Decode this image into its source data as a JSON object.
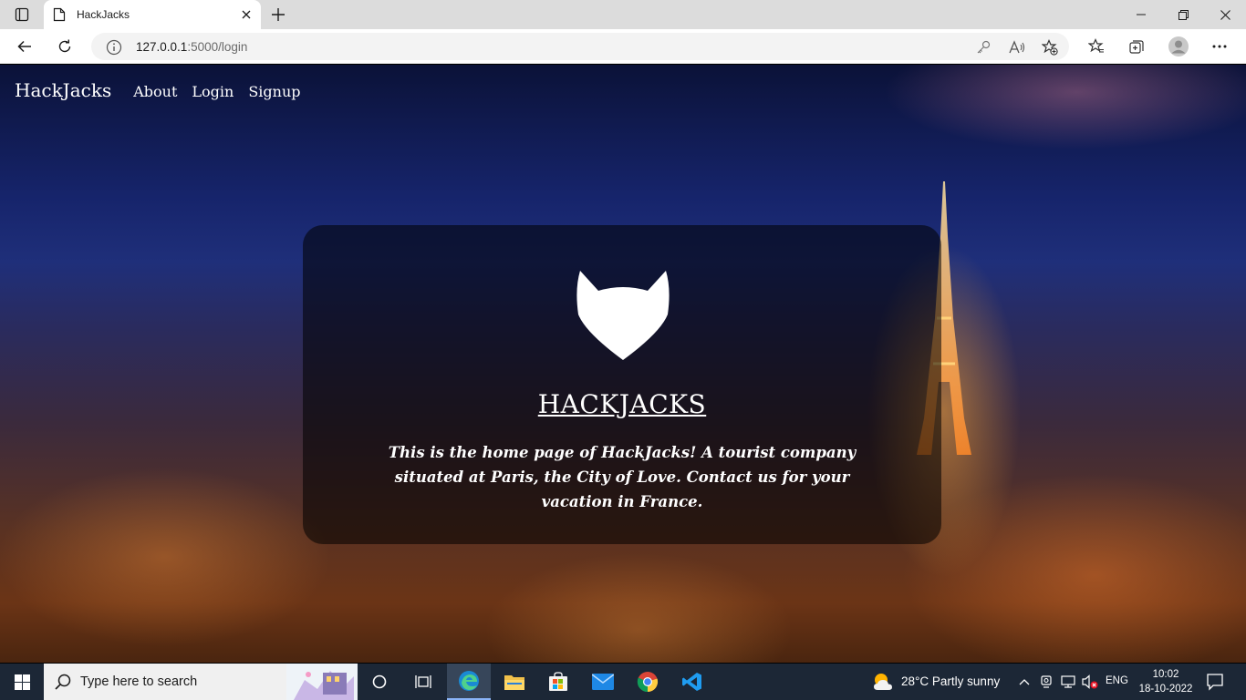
{
  "browser": {
    "tab_title": "HackJacks",
    "url_host": "127.0.0.1",
    "url_path": ":5000/login"
  },
  "site": {
    "brand": "HackJacks",
    "nav": [
      "About",
      "Login",
      "Signup"
    ],
    "hero_title": "HACKJACKS",
    "hero_text": "This is the home page of HackJacks! A tourist company situated at Paris, the City of Love. Contact us for your vacation in France."
  },
  "taskbar": {
    "search_placeholder": "Type here to search",
    "weather": "28°C  Partly sunny",
    "language": "ENG",
    "time": "10:02",
    "date": "18-10-2022"
  },
  "icons": {
    "browser": [
      "tab-actions-icon",
      "page-icon",
      "close-icon",
      "plus-icon",
      "minimize-icon",
      "restore-icon",
      "window-close-icon",
      "back-icon",
      "refresh-icon",
      "info-icon",
      "key-icon",
      "read-aloud-icon",
      "add-favorite-icon",
      "favorites-icon",
      "collections-icon",
      "profile-icon",
      "more-icon"
    ],
    "taskbar": [
      "windows-icon",
      "search-icon",
      "cortana-icon",
      "task-view-icon",
      "edge-icon",
      "file-explorer-icon",
      "store-icon",
      "mail-icon",
      "chrome-icon",
      "vscode-icon",
      "weather-icon",
      "chevron-up-icon",
      "network-icon",
      "volume-muted-icon",
      "notification-icon"
    ],
    "site": [
      "gitlab-fox-logo"
    ]
  },
  "colors": {
    "taskbar_bg": "#1c2736",
    "tabstrip_bg": "#dcdcdc",
    "card_overlay": "rgba(0,0,0,0.55)",
    "night_sky": "#16246b"
  }
}
